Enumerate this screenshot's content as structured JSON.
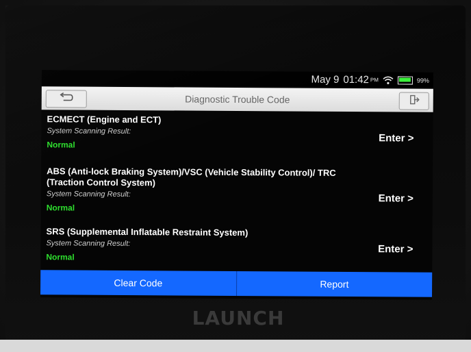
{
  "statusbar": {
    "date": "May 9",
    "time": "01:42",
    "ampm": "PM",
    "battery": "99%",
    "icons": {
      "wifi": "wifi-icon",
      "battery": "battery-icon"
    }
  },
  "titlebar": {
    "title": "Diagnostic Trouble Code",
    "icons": {
      "back": "back-arrow-icon",
      "exit": "exit-icon"
    }
  },
  "systems": [
    {
      "name": "ECMECT (Engine and ECT)",
      "result_label": "System Scanning Result:",
      "status": "Normal",
      "action": "Enter >"
    },
    {
      "name": "ABS (Anti-lock Braking System)/VSC (Vehicle Stability Control)/ TRC (Traction Control System)",
      "result_label": "System Scanning Result:",
      "status": "Normal",
      "action": "Enter >"
    },
    {
      "name": "SRS (Supplemental Inflatable Restraint System)",
      "result_label": "System Scanning Result:",
      "status": "Normal",
      "action": "Enter >"
    }
  ],
  "bottombar": {
    "clear_code": "Clear Code",
    "report": "Report"
  },
  "device": {
    "brand": "LAUNCH"
  },
  "colors": {
    "accent": "#1468ff",
    "status_normal": "#2ede2e",
    "titlebar": "#e8e8e8"
  }
}
